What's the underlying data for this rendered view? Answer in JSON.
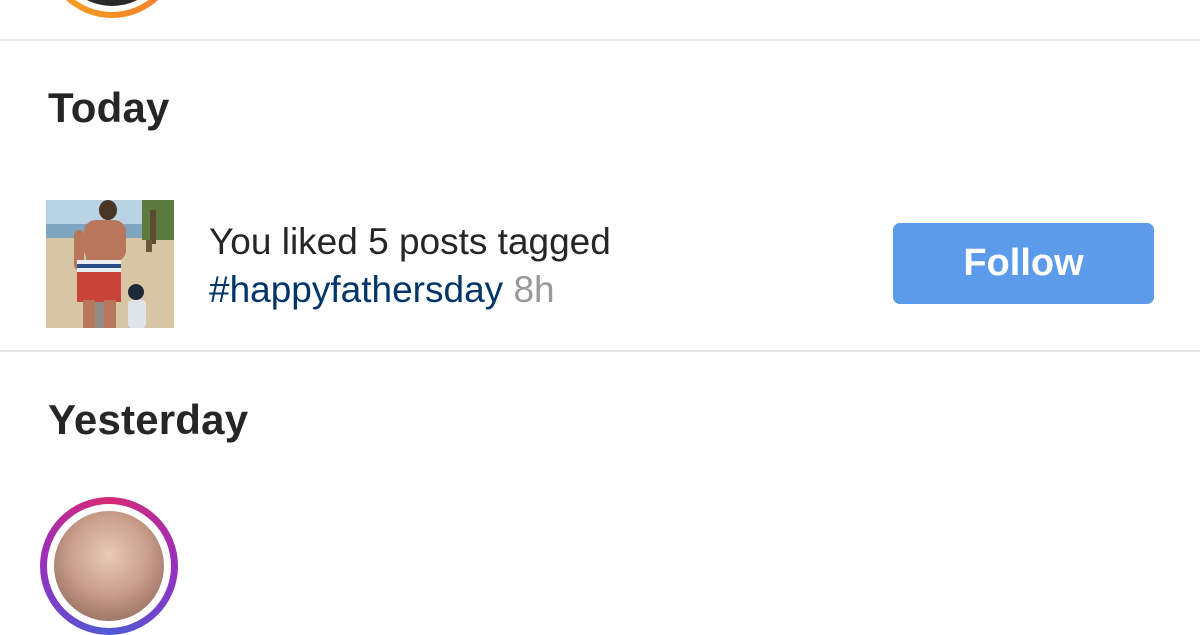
{
  "sections": {
    "today": {
      "title": "Today"
    },
    "yesterday": {
      "title": "Yesterday"
    }
  },
  "notification": {
    "text": "You liked 5 posts tagged ",
    "hashtag": "#happyfathersday",
    "time": "8h",
    "action_label": "Follow",
    "thumbnail_icon": "beach-photo-thumbnail"
  },
  "colors": {
    "follow_button": "#5b9bea",
    "hashtag": "#003569",
    "time": "#999999",
    "divider": "#e6e6e6"
  }
}
